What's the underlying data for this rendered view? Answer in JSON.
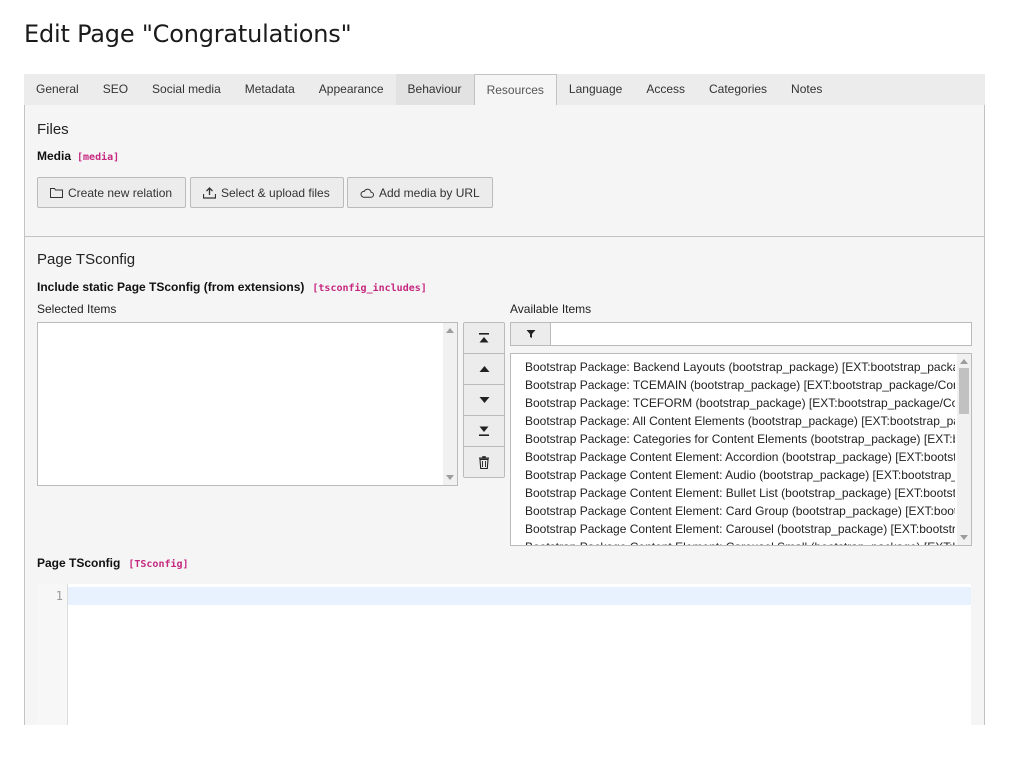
{
  "page": {
    "title": "Edit Page \"Congratulations\""
  },
  "tabs": [
    {
      "label": "General"
    },
    {
      "label": "SEO"
    },
    {
      "label": "Social media"
    },
    {
      "label": "Metadata"
    },
    {
      "label": "Appearance"
    },
    {
      "label": "Behaviour"
    },
    {
      "label": "Resources",
      "active": true
    },
    {
      "label": "Language"
    },
    {
      "label": "Access"
    },
    {
      "label": "Categories"
    },
    {
      "label": "Notes"
    }
  ],
  "files": {
    "heading": "Files",
    "media_label": "Media",
    "media_field": "[media]",
    "buttons": {
      "create": "Create new relation",
      "upload": "Select & upload files",
      "url": "Add media by URL"
    }
  },
  "tsconfig": {
    "heading": "Page TSconfig",
    "include_label": "Include static Page TSconfig (from extensions)",
    "include_field": "[tsconfig_includes]",
    "selected_label": "Selected Items",
    "available_label": "Available Items",
    "filter_value": "",
    "available_items": [
      "Bootstrap Package: Backend Layouts (bootstrap_package) [EXT:bootstrap_package/Configuration/TsConfig/Page/Mod/WebLayout/BackendLayouts.tsconfig]",
      "Bootstrap Package: TCEMAIN (bootstrap_package) [EXT:bootstrap_package/Configuration/TsConfig/Page/TCEMAIN.tsconfig]",
      "Bootstrap Package: TCEFORM (bootstrap_package) [EXT:bootstrap_package/Configuration/TsConfig/Page/TCEFORM.tsconfig]",
      "Bootstrap Package: All Content Elements (bootstrap_package) [EXT:bootstrap_package/Configuration/TsConfig/Page/ContentElement/All.tsconfig]",
      "Bootstrap Package: Categories for Content Elements (bootstrap_package) [EXT:bootstrap_package/Configuration/TsConfig/Page/ContentElement/Categories.tsconfig]",
      "Bootstrap Package Content Element: Accordion (bootstrap_package) [EXT:bootstrap_package/Configuration/TsConfig/Page/ContentElement/Element/Accordion.tsconfig]",
      "Bootstrap Package Content Element: Audio (bootstrap_package) [EXT:bootstrap_package/Configuration/TsConfig/Page/ContentElement/Element/Audio.tsconfig]",
      "Bootstrap Package Content Element: Bullet List (bootstrap_package) [EXT:bootstrap_package/Configuration/TsConfig/Page/ContentElement/Element/Bullets.tsconfig]",
      "Bootstrap Package Content Element: Card Group (bootstrap_package) [EXT:bootstrap_package/Configuration/TsConfig/Page/ContentElement/Element/CardGroup.tsconfig]",
      "Bootstrap Package Content Element: Carousel (bootstrap_package) [EXT:bootstrap_package/Configuration/TsConfig/Page/ContentElement/Element/Carousel.tsconfig]",
      "Bootstrap Package Content Element: Carousel Small (bootstrap_package) [EXT:bootstrap_package/Configuration/TsConfig/Page/ContentElement/Element/CarouselSmall.tsconfig]"
    ],
    "page_label": "Page TSconfig",
    "page_field": "[TSconfig]",
    "editor": {
      "line_number": "1"
    }
  }
}
